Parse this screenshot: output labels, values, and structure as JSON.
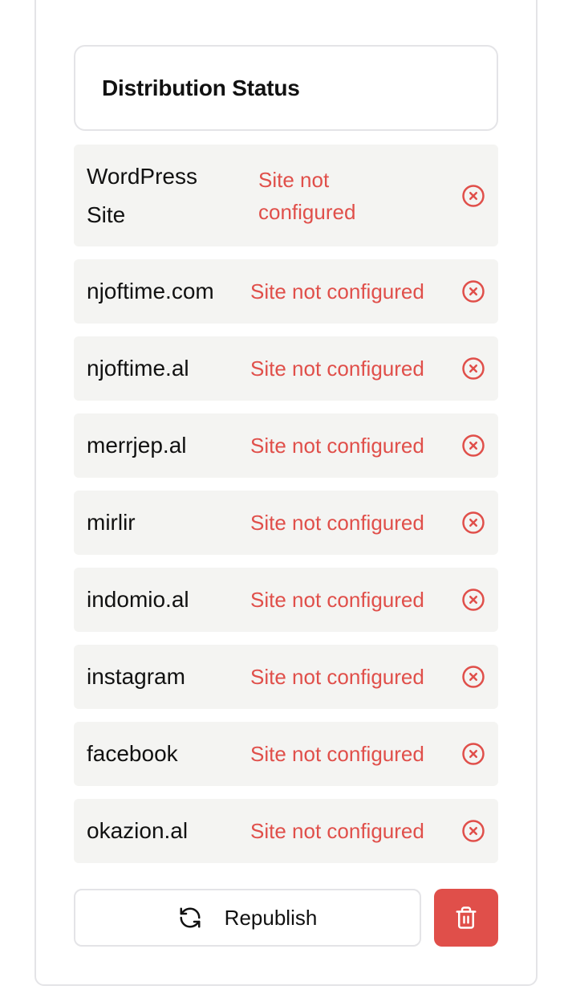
{
  "header": {
    "title": "Distribution Status"
  },
  "rows": [
    {
      "site": "WordPress Site",
      "status": "Site not configured"
    },
    {
      "site": "njoftime.com",
      "status": "Site not configured"
    },
    {
      "site": "njoftime.al",
      "status": "Site not configured"
    },
    {
      "site": "merrjep.al",
      "status": "Site not configured"
    },
    {
      "site": "mirlir",
      "status": "Site not configured"
    },
    {
      "site": "indomio.al",
      "status": "Site not configured"
    },
    {
      "site": "instagram",
      "status": "Site not configured"
    },
    {
      "site": "facebook",
      "status": "Site not configured"
    },
    {
      "site": "okazion.al",
      "status": "Site not configured"
    }
  ],
  "actions": {
    "republish_label": "Republish"
  },
  "colors": {
    "error": "#e04f4a",
    "row_bg": "#f4f4f2",
    "border": "#e4e4e7"
  },
  "icons": {
    "status": "x-circle-icon",
    "republish": "refresh-icon",
    "delete": "trash-icon"
  }
}
